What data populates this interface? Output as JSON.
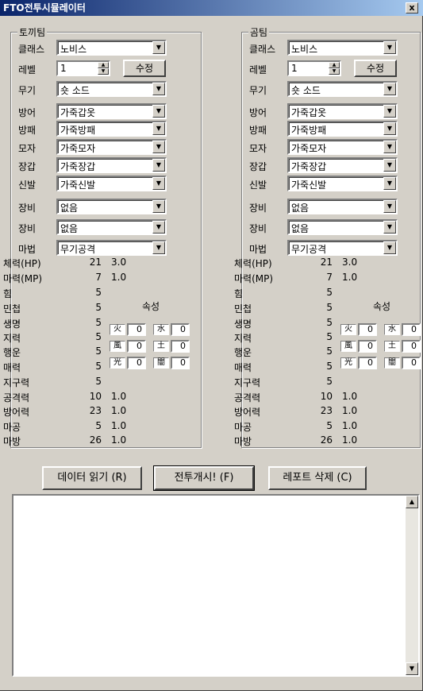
{
  "window": {
    "title": "FTO전투시뮬레이터",
    "close": "x"
  },
  "labels": {
    "class": "클래스",
    "level": "레벨",
    "weapon": "무기",
    "armor": "방어",
    "shield": "방패",
    "hat": "모자",
    "gloves": "장갑",
    "shoes": "신발",
    "equip": "장비",
    "magic": "마법",
    "hp": "체력(HP)",
    "mp": "마력(MP)",
    "str": "힘",
    "agi": "민첩",
    "vit": "생명",
    "int": "지력",
    "luk": "행운",
    "cha": "매력",
    "end": "지구력",
    "atk": "공격력",
    "def": "방어력",
    "matk": "마공",
    "mdef": "마방",
    "element": "속성",
    "edit": "수정"
  },
  "left": {
    "title": "토끼팀",
    "class": "노비스",
    "level": "1",
    "weapon": "숏 소드",
    "armor": "가죽갑옷",
    "shield": "가죽방패",
    "hat": "가죽모자",
    "gloves": "가죽장갑",
    "shoes": "가죽신발",
    "equip1": "없음",
    "equip2": "없음",
    "magic": "무기공격",
    "hp": "21",
    "hp2": "3.0",
    "mp": "7",
    "mp2": "1.0",
    "str": "5",
    "agi": "5",
    "vit": "5",
    "int": "5",
    "luk": "5",
    "cha": "5",
    "end": "5",
    "atk": "10",
    "atk2": "1.0",
    "def": "23",
    "def2": "1.0",
    "matk": "5",
    "matk2": "1.0",
    "mdef": "26",
    "mdef2": "1.0",
    "attrs": [
      {
        "icon": "火",
        "value": "0"
      },
      {
        "icon": "水",
        "value": "0"
      },
      {
        "icon": "風",
        "value": "0"
      },
      {
        "icon": "土",
        "value": "0"
      },
      {
        "icon": "光",
        "value": "0"
      },
      {
        "icon": "闇",
        "value": "0"
      }
    ]
  },
  "right": {
    "title": "곰팀",
    "class": "노비스",
    "level": "1",
    "weapon": "숏 소드",
    "armor": "가죽갑옷",
    "shield": "가죽방패",
    "hat": "가죽모자",
    "gloves": "가죽장갑",
    "shoes": "가죽신발",
    "equip1": "없음",
    "equip2": "없음",
    "magic": "무기공격",
    "hp": "21",
    "hp2": "3.0",
    "mp": "7",
    "mp2": "1.0",
    "str": "5",
    "agi": "5",
    "vit": "5",
    "int": "5",
    "luk": "5",
    "cha": "5",
    "end": "5",
    "atk": "10",
    "atk2": "1.0",
    "def": "23",
    "def2": "1.0",
    "matk": "5",
    "matk2": "1.0",
    "mdef": "26",
    "mdef2": "1.0",
    "attrs": [
      {
        "icon": "火",
        "value": "0"
      },
      {
        "icon": "水",
        "value": "0"
      },
      {
        "icon": "風",
        "value": "0"
      },
      {
        "icon": "土",
        "value": "0"
      },
      {
        "icon": "光",
        "value": "0"
      },
      {
        "icon": "闇",
        "value": "0"
      }
    ]
  },
  "buttons": {
    "load": "데이터 읽기 (R)",
    "start": "전투개시! (F)",
    "clear": "레포트 삭제 (C)"
  },
  "log": {
    "text": ""
  }
}
